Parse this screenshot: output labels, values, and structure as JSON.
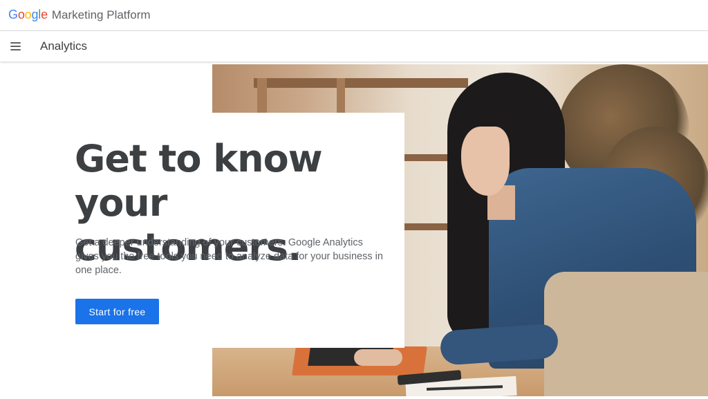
{
  "brand": {
    "google_letters": [
      {
        "ch": "G",
        "color": "#4285f4"
      },
      {
        "ch": "o",
        "color": "#ea4335"
      },
      {
        "ch": "o",
        "color": "#fbbc05"
      },
      {
        "ch": "g",
        "color": "#4285f4"
      },
      {
        "ch": "l",
        "color": "#34a853"
      },
      {
        "ch": "e",
        "color": "#ea4335"
      }
    ],
    "google": "Google",
    "product": "Marketing Platform"
  },
  "nav": {
    "menu_icon": "hamburger-menu-icon",
    "title": "Analytics"
  },
  "hero": {
    "headline_line1": "Get to know",
    "headline_line2": "your customers.",
    "description": "Get a deeper understanding of your customers. Google Analytics gives you the free tools you need to analyze data for your business in one place.",
    "cta_label": "Start for free",
    "accent_color": "#1a73e8"
  }
}
